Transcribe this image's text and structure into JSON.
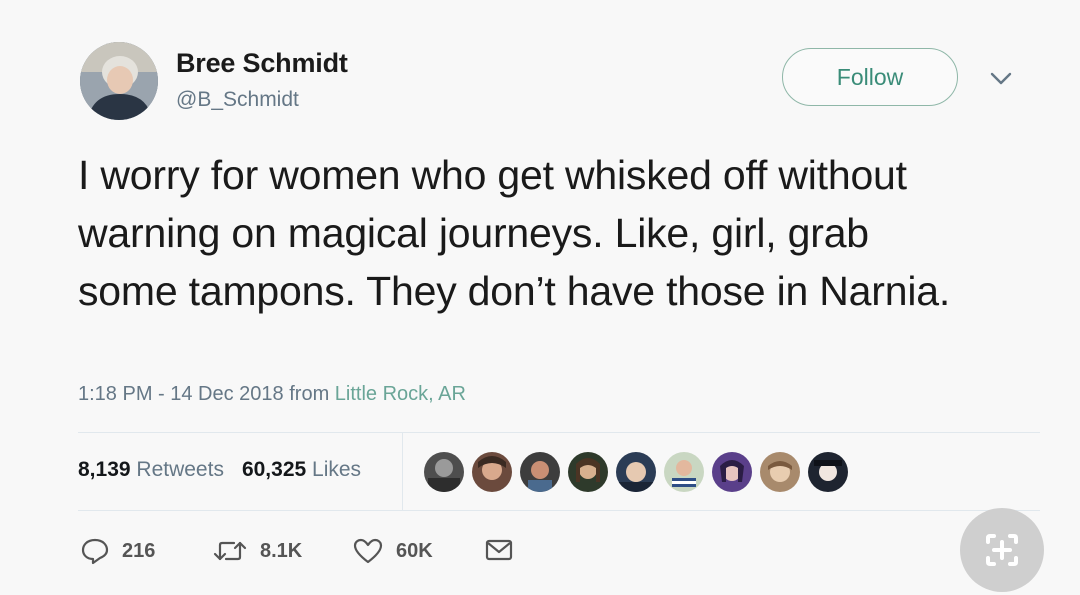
{
  "user": {
    "name": "Bree Schmidt",
    "handle": "@B_Schmidt"
  },
  "follow_label": "Follow",
  "tweet_text": "I worry for women who get whisked off without warning on magical journeys. Like, girl, grab some tampons. They don’t have those in Narnia.",
  "meta": {
    "time_date": "1:18 PM - 14 Dec 2018 from ",
    "location": "Little Rock, AR"
  },
  "stats": {
    "retweets_count": "8,139",
    "retweets_label": "Retweets",
    "likes_count": "60,325",
    "likes_label": "Likes"
  },
  "actions": {
    "replies": "216",
    "retweets": "8.1K",
    "likes": "60K"
  },
  "colors": {
    "accent": "#3a8c78",
    "link": "#6aa597",
    "muted": "#657786"
  }
}
